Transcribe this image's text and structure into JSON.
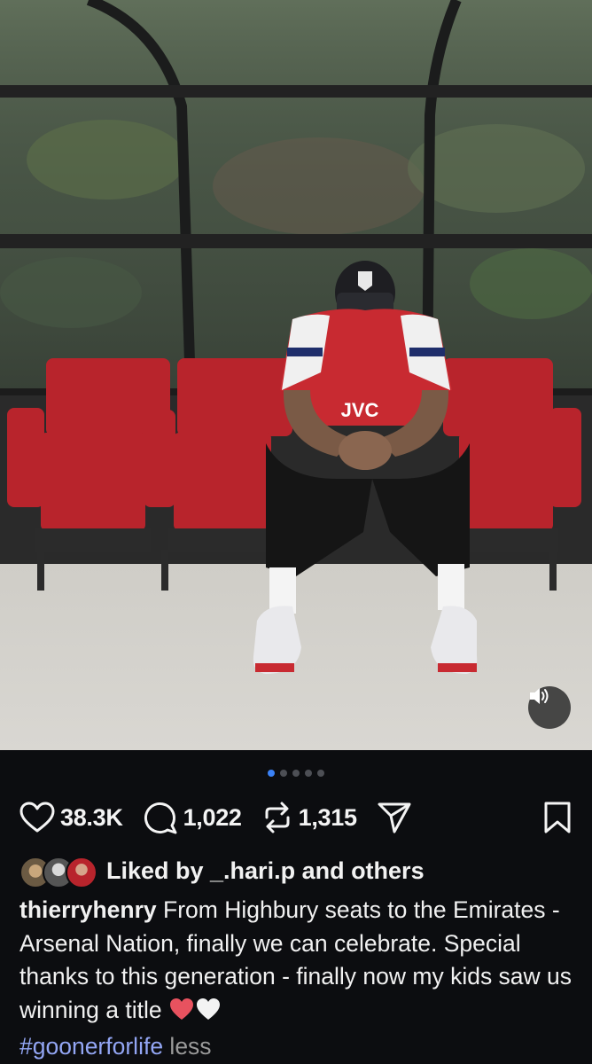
{
  "post": {
    "likes_count": "38.3K",
    "comments_count": "1,022",
    "reposts_count": "1,315",
    "carousel": {
      "total": 5,
      "active_index": 0
    },
    "jersey_text": "JVC"
  },
  "liked_by": {
    "prefix": "Liked by ",
    "name": "_.hari.p",
    "suffix": " and others"
  },
  "caption": {
    "username": "thierryhenry",
    "text": " From Highbury seats to the Emirates - Arsenal Nation, finally we can celebrate. Special thanks to this generation - finally now my kids saw us winning a title ",
    "hashtag": "#goonerforlife",
    "more_label": " less"
  },
  "icons": {
    "like": "heart-icon",
    "comment": "comment-bubble-icon",
    "repost": "repost-icon",
    "share": "send-icon",
    "save": "bookmark-icon",
    "sound": "speaker-icon"
  },
  "colors": {
    "background": "#0c0d10",
    "active_dot": "#3b82f6",
    "hashtag": "#93a6f4",
    "seat_red": "#b8242c"
  }
}
